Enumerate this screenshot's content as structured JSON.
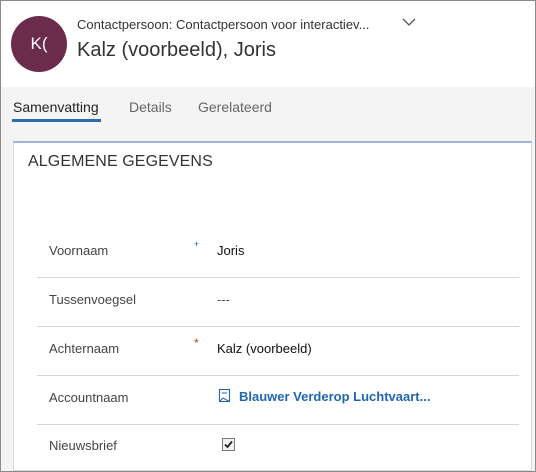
{
  "header": {
    "avatar_initials": "K(",
    "avatar_color": "#6b2b4b",
    "form_selector": "Contactpersoon: Contactpersoon voor interactiev...",
    "record_title": "Kalz (voorbeeld), Joris"
  },
  "tabs": [
    {
      "label": "Samenvatting",
      "active": true
    },
    {
      "label": "Details",
      "active": false
    },
    {
      "label": "Gerelateerd",
      "active": false
    }
  ],
  "section": {
    "title": "ALGEMENE GEGEVENS"
  },
  "fields": [
    {
      "label": "Voornaam",
      "value": "Joris",
      "required": "recommended"
    },
    {
      "label": "Tussenvoegsel",
      "value": "---",
      "required": "none"
    },
    {
      "label": "Achternaam",
      "value": "Kalz (voorbeeld)",
      "required": "required"
    },
    {
      "label": "Accountnaam",
      "value": "Blauwer Verderop Luchtvaart...",
      "icon": "account-lookup-icon"
    },
    {
      "label": "Nieuwsbrief",
      "checked": true
    }
  ],
  "markers": {
    "recommended": "+",
    "required": "*"
  },
  "colors": {
    "accent": "#2b6cb0",
    "link": "#2266b0",
    "required": "#c0392b"
  }
}
